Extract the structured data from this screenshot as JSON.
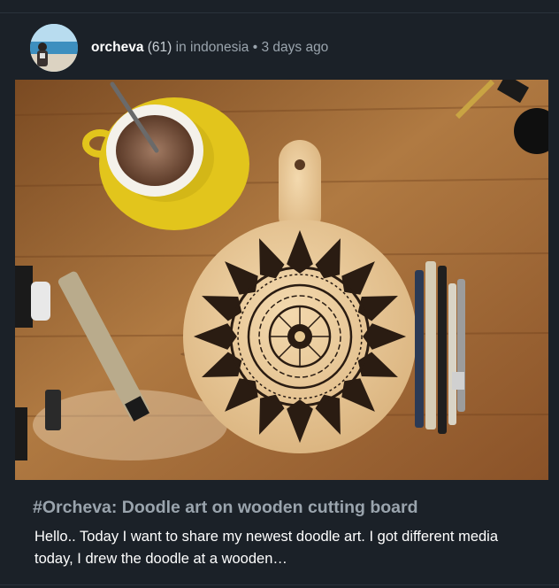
{
  "post": {
    "author": "orcheva",
    "reputation": "(61)",
    "in_text": "in",
    "community": "indonesia",
    "separator": "•",
    "time_ago": "3 days ago",
    "title": "#Orcheva: Doodle art on wooden cutting board",
    "excerpt": "Hello.. Today I want to share my newest doodle art. I got different media today, I drew the doodle at a wooden…"
  },
  "colors": {
    "background": "#1b2128",
    "title": "#9aa4ad",
    "excerpt": "#ffffff",
    "meta": "#9aa4ad"
  },
  "icons": {
    "avatar": "user-avatar-photo",
    "image": "doodle-cutting-board-photo"
  }
}
